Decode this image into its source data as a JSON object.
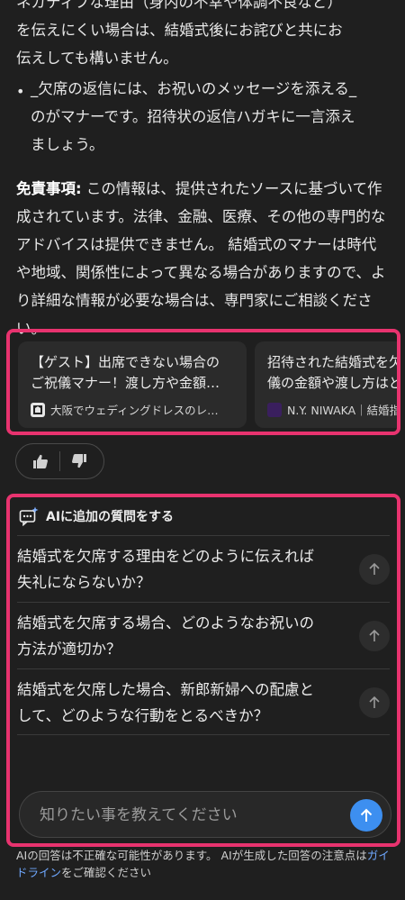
{
  "answer": {
    "para1_lines": "ネガティブな理由（身内の不幸や体調不良など）\nを伝えにくい場合は、結婚式後にお詫びと共にお\n伝えしても構いません。",
    "bullet2": "_欠席の返信には、お祝いのメッセージを添える_\nのがマナーです。招待状の返信ハガキに一言添え\nましょう。",
    "disclaimer_label": "免責事項:",
    "disclaimer_text": " この情報は、提供されたソースに基づいて作成されています。法律、金融、医療、その他の専門的なアドバイスは提供できません。 結婚式のマナーは時代や地域、関係性によって異なる場合がありますので、より詳細な情報が必要な場合は、専門家にご相談ください。"
  },
  "sources": [
    {
      "title": "【ゲスト】出席できない場合の\nご祝儀マナー！渡し方や金額…",
      "site": "大阪でウェディングドレスのレ…",
      "favicon_color": "#e6e6e6"
    },
    {
      "title": "招待された結婚式を欠\n儀の金額や渡し方はど",
      "site": "N.Y. NIWAKA｜結婚指",
      "favicon_color": "#3a1f5e"
    }
  ],
  "feedback": {
    "like_icon": "thumbs-up-icon",
    "dislike_icon": "thumbs-down-icon"
  },
  "ai_followup": {
    "header": "AIに追加の質問をする",
    "questions": [
      "結婚式を欠席する理由をどのように伝えれば\n失礼にならないか？",
      "結婚式を欠席する場合、どのようなお祝いの\n方法が適切か？",
      "結婚式を欠席した場合、新郎新婦への配慮と\nして、どのような行動をとるべきか？"
    ],
    "input_placeholder": "知りたい事を教えてください"
  },
  "footer": {
    "text1": "AIの回答は不正確な可能性があります。 AIが生成した回答の注意点は",
    "link": "ガイドライン",
    "text2": "をご確認ください"
  },
  "colors": {
    "accent": "#e8336f",
    "send": "#3d8ff0",
    "link": "#6fa8ff"
  }
}
